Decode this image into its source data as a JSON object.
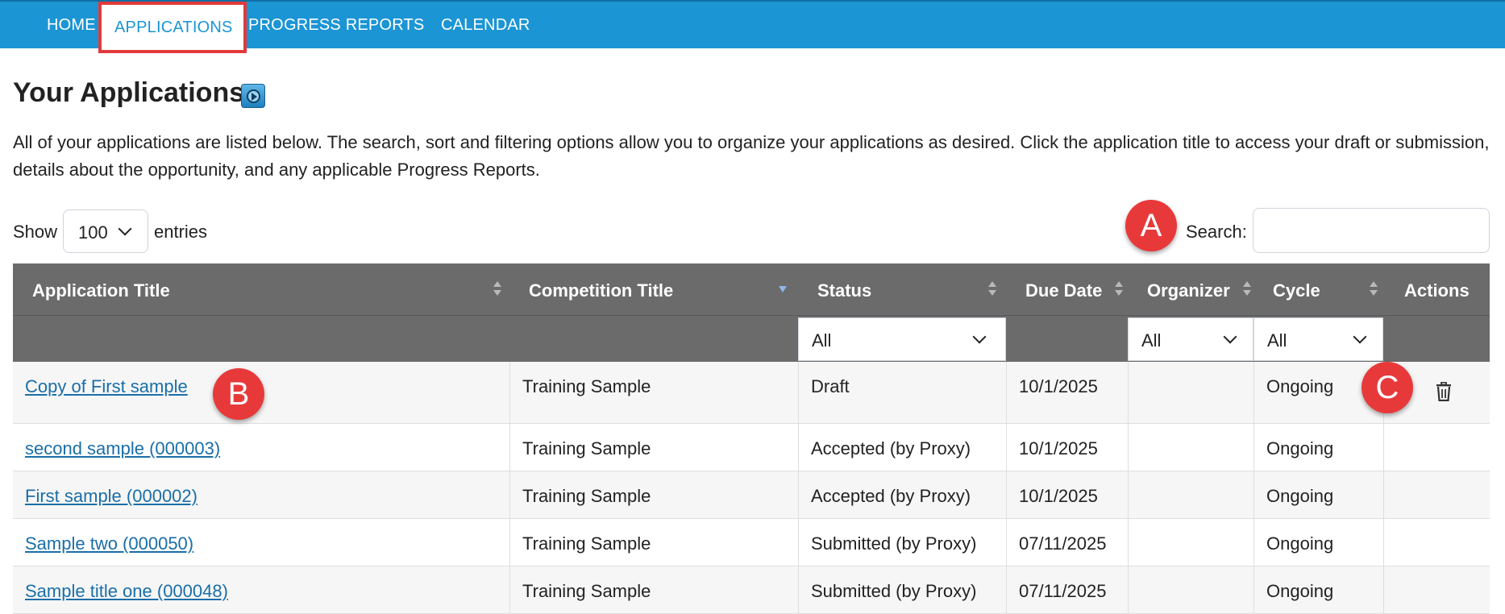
{
  "nav": {
    "items": [
      "HOME",
      "APPLICATIONS",
      "PROGRESS REPORTS",
      "CALENDAR"
    ],
    "active": "APPLICATIONS"
  },
  "page": {
    "title": "Your Applications",
    "intro": "All of your applications are listed below. The search, sort and filtering options allow you to organize your applications as desired. Click the application title to access your draft or submission, details about the opportunity, and any applicable Progress Reports."
  },
  "controls": {
    "show_label": "Show",
    "page_size": "100",
    "entries_label": "entries",
    "search_label": "Search:",
    "search_value": ""
  },
  "markers": [
    "A",
    "B",
    "C"
  ],
  "table": {
    "columns": [
      "Application Title",
      "Competition Title",
      "Status",
      "Due Date",
      "Organizer",
      "Cycle",
      "Actions"
    ],
    "filters": {
      "status": "All",
      "organizer": "All",
      "cycle": "All"
    },
    "rows": [
      {
        "title": "Copy of First sample",
        "competition": "Training Sample",
        "status": "Draft",
        "due": "10/1/2025",
        "organizer": "",
        "cycle": "Ongoing"
      },
      {
        "title": "second sample (000003)",
        "competition": "Training Sample",
        "status": "Accepted (by Proxy)",
        "due": "10/1/2025",
        "organizer": "",
        "cycle": "Ongoing"
      },
      {
        "title": "First sample (000002)",
        "competition": "Training Sample",
        "status": "Accepted (by Proxy)",
        "due": "10/1/2025",
        "organizer": "",
        "cycle": "Ongoing"
      },
      {
        "title": "Sample two (000050)",
        "competition": "Training Sample",
        "status": "Submitted (by Proxy)",
        "due": "07/11/2025",
        "organizer": "",
        "cycle": "Ongoing"
      },
      {
        "title": "Sample title one (000048)",
        "competition": "Training Sample",
        "status": "Submitted (by Proxy)",
        "due": "07/11/2025",
        "organizer": "",
        "cycle": "Ongoing"
      }
    ]
  },
  "colors": {
    "nav_bg": "#1b95d4",
    "header_bg": "#6b6b6b",
    "link": "#1a6ea8",
    "marker": "#e8393a",
    "highlight": "#e23a3a"
  },
  "icons": {
    "video": "video-play-icon",
    "delete": "trash-icon"
  }
}
